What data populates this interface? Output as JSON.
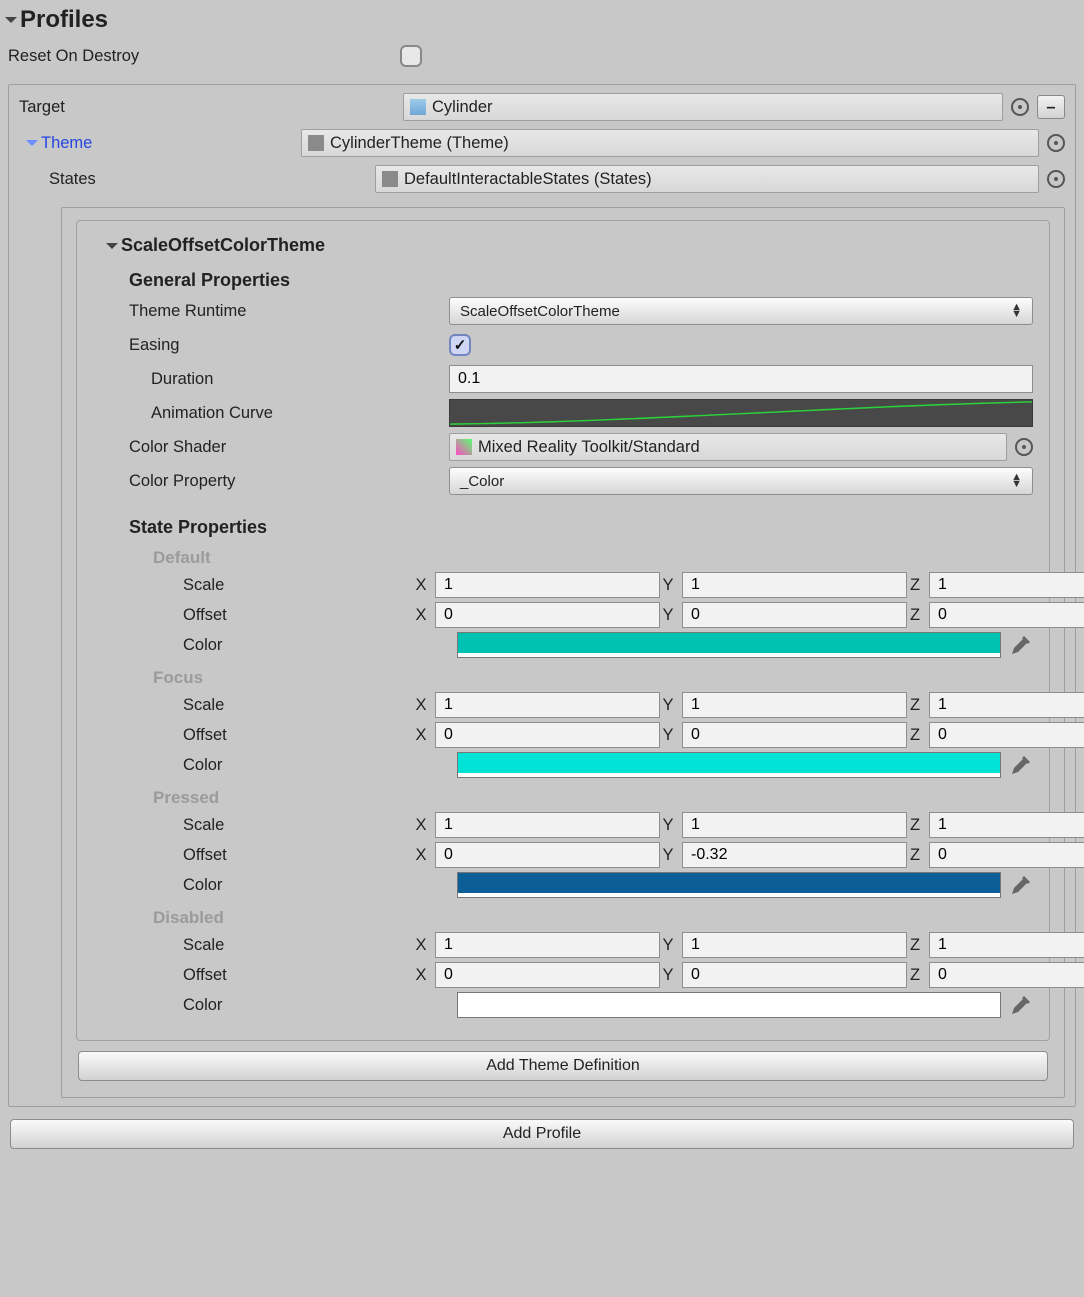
{
  "header": {
    "title": "Profiles",
    "resetOnDestroy": "Reset On Destroy"
  },
  "top": {
    "targetLabel": "Target",
    "targetValue": "Cylinder",
    "themeLabel": "Theme",
    "themeValue": "CylinderTheme (Theme)",
    "statesLabel": "States",
    "statesValue": "DefaultInteractableStates (States)",
    "minus": "–"
  },
  "theme": {
    "title": "ScaleOffsetColorTheme",
    "generalHeader": "General Properties",
    "runtimeLabel": "Theme Runtime",
    "runtimeValue": "ScaleOffsetColorTheme",
    "easingLabel": "Easing",
    "durationLabel": "Duration",
    "durationValue": "0.1",
    "curveLabel": "Animation Curve",
    "shaderLabel": "Color Shader",
    "shaderValue": "Mixed Reality Toolkit/Standard",
    "colorPropLabel": "Color Property",
    "colorPropValue": "_Color",
    "statePropsHeader": "State Properties",
    "axes": {
      "x": "X",
      "y": "Y",
      "z": "Z"
    },
    "fields": {
      "scale": "Scale",
      "offset": "Offset",
      "color": "Color"
    },
    "states": {
      "Default": {
        "label": "Default",
        "scale": {
          "x": "1",
          "y": "1",
          "z": "1"
        },
        "offset": {
          "x": "0",
          "y": "0",
          "z": "0"
        },
        "colorHex": "#00c2b2"
      },
      "Focus": {
        "label": "Focus",
        "scale": {
          "x": "1",
          "y": "1",
          "z": "1"
        },
        "offset": {
          "x": "0",
          "y": "0",
          "z": "0"
        },
        "colorHex": "#00e3d6"
      },
      "Pressed": {
        "label": "Pressed",
        "scale": {
          "x": "1",
          "y": "1",
          "z": "1"
        },
        "offset": {
          "x": "0",
          "y": "-0.32",
          "z": "0"
        },
        "colorHex": "#0b5e98"
      },
      "Disabled": {
        "label": "Disabled",
        "scale": {
          "x": "1",
          "y": "1",
          "z": "1"
        },
        "offset": {
          "x": "0",
          "y": "0",
          "z": "0"
        },
        "colorHex": "#ffffff"
      }
    }
  },
  "buttons": {
    "addThemeDef": "Add Theme Definition",
    "addProfile": "Add Profile"
  }
}
